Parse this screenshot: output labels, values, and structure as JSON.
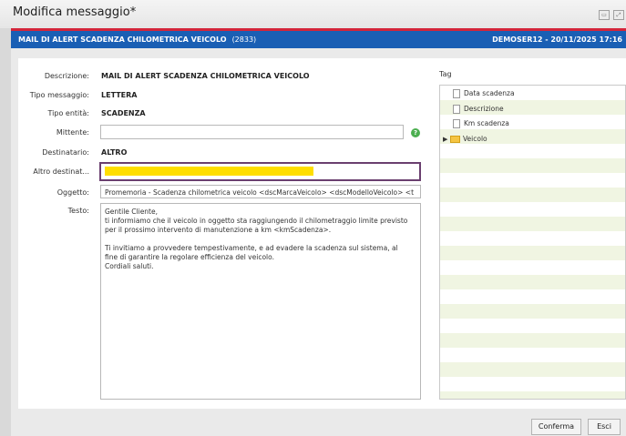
{
  "window": {
    "title": "Modifica messaggio*",
    "controls": [
      "restore-icon",
      "maximize-icon"
    ]
  },
  "header": {
    "title": "MAIL DI ALERT SCADENZA CHILOMETRICA VEICOLO",
    "code": "(2833)",
    "user_date": "DEMOSER12 - 20/11/2025 17:16",
    "accent_color": "#d4253a",
    "bar_color": "#1a5fb4"
  },
  "form": {
    "descrizione": {
      "label": "Descrizione:",
      "value": "MAIL DI ALERT SCADENZA CHILOMETRICA VEICOLO"
    },
    "tipo_messaggio": {
      "label": "Tipo messaggio:",
      "value": "LETTERA"
    },
    "tipo_entita": {
      "label": "Tipo entità:",
      "value": "SCADENZA"
    },
    "mittente": {
      "label": "Mittente:",
      "value": ""
    },
    "destinatario": {
      "label": "Destinatario:",
      "value": "ALTRO"
    },
    "altro_destinatario": {
      "label": "Altro destinat...",
      "value": ""
    },
    "oggetto": {
      "label": "Oggetto:",
      "value": "Promemoria - Scadenza chilometrica veicolo <dscMarcaVeicolo> <dscModelloVeicolo> <t"
    },
    "testo": {
      "label": "Testo:",
      "value": "Gentile Cliente,\nti informiamo che il veicolo in oggetto sta raggiungendo il chilometraggio limite previsto\nper il prossimo intervento di manutenzione a km <kmScadenza>.\n\nTi invitiamo a provvedere tempestivamente, e ad evadere la scadenza sul sistema, al\nfine di garantire la regolare efficienza del veicolo.\nCordiali saluti."
    }
  },
  "tags": {
    "header": "Tag",
    "items": [
      {
        "label": "Data scadenza",
        "icon": "document-icon"
      },
      {
        "label": "Descrizione",
        "icon": "document-icon"
      },
      {
        "label": "Km scadenza",
        "icon": "document-icon"
      },
      {
        "label": "Veicolo",
        "icon": "folder-icon"
      }
    ]
  },
  "buttons": {
    "confirm": "Conferma",
    "exit": "Esci"
  }
}
